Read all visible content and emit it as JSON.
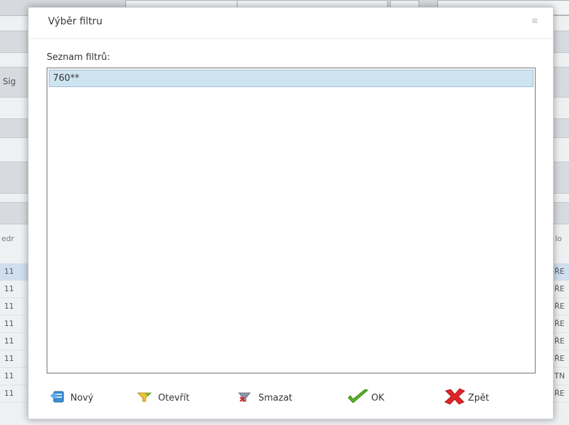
{
  "dialog": {
    "title": "Výběr filtru",
    "close_glyph": "⊠",
    "list_label": "Seznam filtrů:",
    "filters": [
      "760**"
    ],
    "buttons": {
      "new": "Nový",
      "open": "Otevřít",
      "delete": "Smazat",
      "ok": "OK",
      "back": "Zpět"
    }
  },
  "background": {
    "side_label_left": "Sig",
    "column_header_left": "edr",
    "column_header_right": "lo",
    "row_left_values": [
      "11",
      "11",
      "11",
      "11",
      "11",
      "11",
      "11",
      "11"
    ],
    "row_right_values": [
      "ŘE",
      "ŘE",
      "ŘE",
      "ŘE",
      "ŘE",
      "ŘE",
      "TN",
      "ŘE"
    ]
  },
  "colors": {
    "selected_item_bg": "#cfe4f1",
    "ok_icon": "#5bb026",
    "back_icon": "#e0262a"
  }
}
